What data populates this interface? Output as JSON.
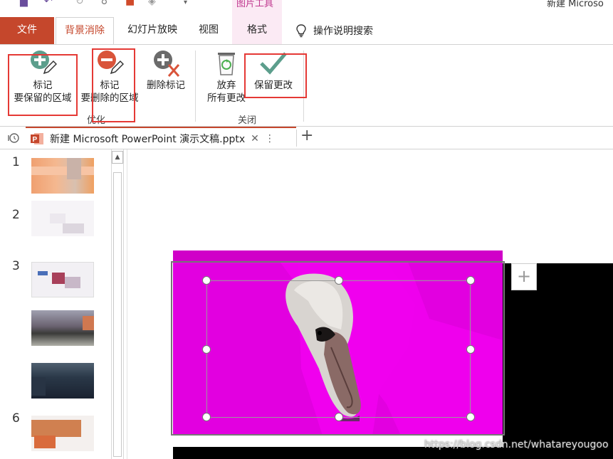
{
  "title_bar": {
    "context_tab_group": "图片工具",
    "app_title": "新建 Microso"
  },
  "tabs": {
    "file": "文件",
    "background_removal": "背景消除",
    "slideshow": "幻灯片放映",
    "view": "视图",
    "format": "格式",
    "tell_me": "操作说明搜索"
  },
  "ribbon": {
    "refine_group": {
      "label": "优化",
      "mark_keep": [
        "标记",
        "要保留的区域"
      ],
      "mark_remove": [
        "标记",
        "要删除的区域"
      ],
      "delete_mark": "删除标记"
    },
    "close_group": {
      "label": "关闭",
      "discard": [
        "放弃",
        "所有更改"
      ],
      "keep_changes": "保留更改"
    }
  },
  "document_tab": {
    "filename": "新建 Microsoft PowerPoint 演示文稿.pptx",
    "close_symbol": "✕",
    "more_symbol": "⋮",
    "new_tab_symbol": "+"
  },
  "slides": [
    {
      "number": "1"
    },
    {
      "number": "2"
    },
    {
      "number": "3"
    },
    {
      "number": ""
    },
    {
      "number": ""
    },
    {
      "number": "6"
    }
  ],
  "canvas": {
    "add_button": "+"
  },
  "watermark": "https://blog.csdn.net/whatareyougoo",
  "colors": {
    "accent": "#c5472c",
    "removal_magenta": "#e200e0",
    "highlight_red": "#e53935"
  }
}
